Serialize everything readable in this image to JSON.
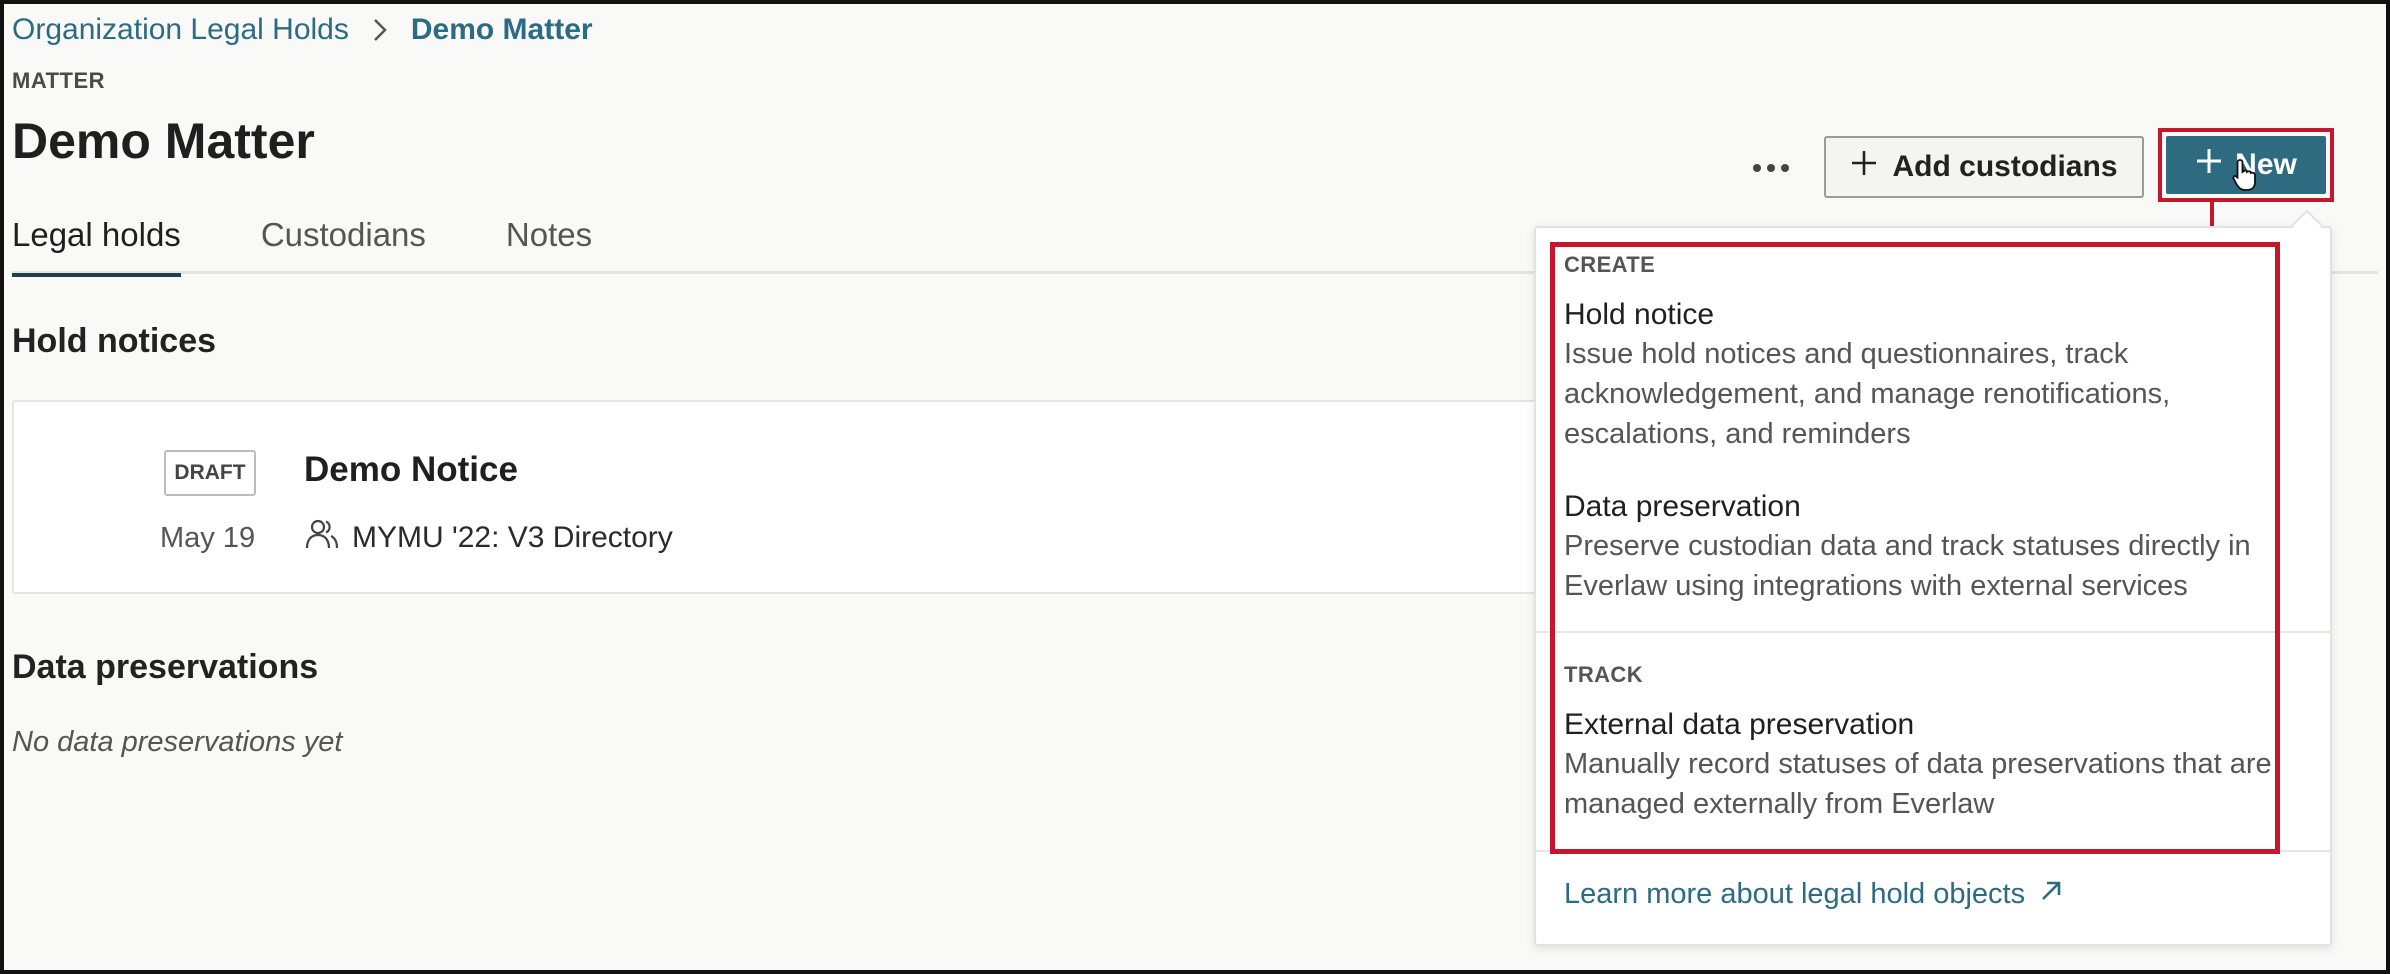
{
  "breadcrumb": {
    "parent": "Organization Legal Holds",
    "current": "Demo Matter"
  },
  "header": {
    "eyebrow": "MATTER",
    "title": "Demo Matter",
    "more_icon": "more-horizontal-icon",
    "add_custodians_label": "Add custodians",
    "new_label": "New"
  },
  "tabs": [
    {
      "label": "Legal holds",
      "active": true
    },
    {
      "label": "Custodians",
      "active": false
    },
    {
      "label": "Notes",
      "active": false
    }
  ],
  "hold_notices": {
    "title": "Hold notices",
    "items": [
      {
        "status": "DRAFT",
        "date": "May 19",
        "name": "Demo Notice",
        "group": "MYMU '22: V3 Directory",
        "group_icon": "people-icon"
      }
    ]
  },
  "data_preservations": {
    "title": "Data preservations",
    "empty_text": "No data preservations yet"
  },
  "new_menu": {
    "create_label": "CREATE",
    "create_items": [
      {
        "title": "Hold notice",
        "description": "Issue hold notices and questionnaires, track acknowledgement, and manage renotifications, escalations, and reminders"
      },
      {
        "title": "Data preservation",
        "description": "Preserve custodian data and track statuses directly in Everlaw using integrations with external services"
      }
    ],
    "track_label": "TRACK",
    "track_items": [
      {
        "title": "External data preservation",
        "description": "Manually record statuses of data preservations that are managed externally from Everlaw"
      }
    ],
    "learn_more": "Learn more about legal hold objects"
  },
  "colors": {
    "accent": "#2e6a80",
    "link": "#2b6b84",
    "highlight": "#c5162c"
  }
}
